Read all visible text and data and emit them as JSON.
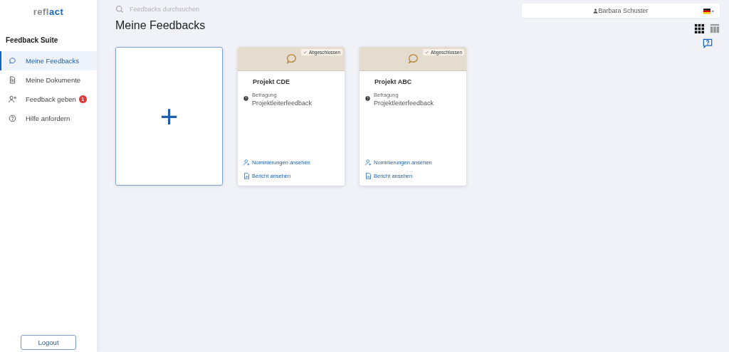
{
  "logo": {
    "part1": "refl",
    "part2": "act"
  },
  "sidebar": {
    "section": "Feedback Suite",
    "items": [
      {
        "label": "Meine Feedbacks",
        "kind": "chat",
        "selected": true
      },
      {
        "label": "Meine Dokumente",
        "kind": "document",
        "selected": false
      },
      {
        "label": "Feedback geben",
        "kind": "person",
        "selected": false,
        "badge": "1"
      },
      {
        "label": "Hilfe anfordern",
        "kind": "help",
        "selected": false
      }
    ],
    "logout": "Logout"
  },
  "search": {
    "placeholder": "Feedbacks durchsuchen"
  },
  "user": {
    "name": "Barbara Schuster"
  },
  "title": "Meine Feedbacks",
  "views": [
    {
      "kind": "grid",
      "selected": true
    },
    {
      "kind": "table",
      "selected": false
    }
  ],
  "add_card": {
    "label": "+"
  },
  "cards": [
    {
      "status": "Abgeschlossen",
      "title": "Projekt CDE",
      "type": "Befragung",
      "name": "Projektleiterfeedback",
      "links": [
        {
          "kind": "nominations",
          "label": "Nominierungen ansehen"
        },
        {
          "kind": "report",
          "label": "Bericht ansehen"
        }
      ]
    },
    {
      "status": "Abgeschlossen",
      "title": "Projekt ABC",
      "type": "Befragung",
      "name": "Projektleiterfeedback",
      "links": [
        {
          "kind": "nominations",
          "label": "Nominierungen ansehen"
        },
        {
          "kind": "report",
          "label": "Bericht ansehen"
        }
      ]
    }
  ]
}
